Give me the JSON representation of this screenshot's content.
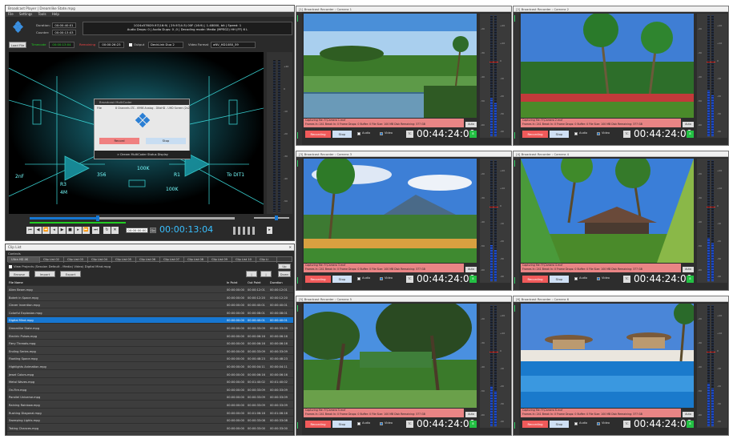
{
  "player": {
    "title": "Broadcast Player | Dreamlike State.mpg",
    "menu": [
      "File",
      "Settings",
      "Tools",
      "Help"
    ],
    "duration_label": "Duration:",
    "duration": "00:00:40:01",
    "counter_label": "Counter:",
    "counter": "00:00:13:03",
    "info_line1": "1024x576i29.97(16:9) | 29.97(4:3) 00F (16:9) | 1.48000, bit | Speed: 1",
    "info_line2": "Audio Drops: 0 | Audio Dups: 0 ,0 | Decoding mode: Media (MPEG2) HH (FF) 6 L",
    "load_file": "Load File",
    "timecode_label": "Timecode",
    "timecode": "00:00:13:04",
    "remaining_label": "Remaining",
    "remaining": "00:00:26:23",
    "output_label": "Output",
    "output_value": "DeckLink Duo 2",
    "video_format_label": "Video Format",
    "video_format_value": "aNV_HD1080_59",
    "big_timecode": "00:00:13:04",
    "tc_field": "00:00:00:00",
    "go": "Go",
    "meter_scale": [
      "+20",
      "0",
      "-10",
      "-20",
      "-30",
      "-40",
      "-50"
    ],
    "dialog": {
      "title": "Broadcast MultiCoder",
      "file_menu": "File",
      "caption": "8 Channels LTC - 6998 Analog - DNxHD - UHD Screen (2x2)",
      "record": "Record",
      "stop": "Stop",
      "footer": "> Dream MultiCoder Status Display"
    },
    "video_text": [
      "2nF",
      "R3",
      "4M",
      "R1",
      "100K",
      "100K",
      "356",
      "To DIT1"
    ]
  },
  "cliplist": {
    "title": "Clip List",
    "controls_label": "Controls",
    "tabs": [
      "Ultra HD 4K",
      "Clip List 02",
      "Clip List 03",
      "Clip List 04",
      "Clip List 05",
      "Clip List 06",
      "Clip List 07",
      "Clip List 08",
      "Clip List 09",
      "Clip List 10",
      "Clip Li"
    ],
    "path_label": "View Projects (Session Default - Media) Video) Digital Mind.mpg",
    "browse": "Browse",
    "import": "Import",
    "export": "Export",
    "up": "Up",
    "down": "Down",
    "headers": [
      "File Name",
      "In Point",
      "Out Point",
      "Duration"
    ],
    "rows": [
      [
        "Alien Beam.mpg",
        "00:00:00:00",
        "00:00:12:01",
        "00:00:12:01"
      ],
      [
        "Bokeh in Space.mpg",
        "00:00:00:00",
        "00:00:12:20",
        "00:00:12:20"
      ],
      [
        "Clever Invention.mpg",
        "00:00:00:00",
        "00:00:40:01",
        "00:00:40:01"
      ],
      [
        "Colorful Explosion.mpg",
        "00:00:00:00",
        "00:00:08:01",
        "00:00:08:01"
      ],
      [
        "Digital Mind.mpg",
        "00:00:00:00",
        "00:00:40:01",
        "00:00:40:01"
      ],
      [
        "Dreamlike State.mpg",
        "00:00:00:00",
        "00:00:33:09",
        "00:00:33:09"
      ],
      [
        "Electric Pulses.mpg",
        "00:00:00:00",
        "00:00:06:16",
        "00:00:06:16"
      ],
      [
        "Fiery Threads.mpg",
        "00:00:00:00",
        "00:00:06:16",
        "00:00:06:16"
      ],
      [
        "Ending Series.mpg",
        "00:00:00:00",
        "00:00:33:09",
        "00:00:33:09"
      ],
      [
        "Floating Space.mpg",
        "00:00:00:00",
        "00:00:48:23",
        "00:00:48:23"
      ],
      [
        "Highlights Animation.mpg",
        "00:00:00:00",
        "00:00:04:11",
        "00:00:04:11"
      ],
      [
        "Jewel Colors.mpg",
        "00:00:00:00",
        "00:00:06:16",
        "00:00:06:16"
      ],
      [
        "Metal Waves.mpg",
        "00:00:00:00",
        "00:01:40:02",
        "00:01:40:02"
      ],
      [
        "On-Fire.mpg",
        "00:00:00:00",
        "00:00:33:09",
        "00:00:33:09"
      ],
      [
        "Parallel Universe.mpg",
        "00:00:00:00",
        "00:00:33:09",
        "00:00:33:09"
      ],
      [
        "Raining Rainbow.mpg",
        "00:00:00:00",
        "00:00:33:09",
        "00:00:33:09"
      ],
      [
        "Rushing Diagonal.mpg",
        "00:00:00:00",
        "00:01:06:16",
        "00:01:06:16"
      ],
      [
        "Sweeping Lights.mpg",
        "00:00:00:00",
        "00:00:33:08",
        "00:00:33:08"
      ],
      [
        "Taking Chances.mpg",
        "00:00:00:00",
        "00:00:33:00",
        "00:00:33:00"
      ]
    ],
    "selected_index": 4
  },
  "cameras": [
    {
      "title": "[1] Broadcast Recorder : Camera 1",
      "capture": "Capturing file: F:\\Camera 1.mxf",
      "frames": "Frames In: 241   Break In: 0   Frame Drops: 0   Buffer: 0   File Size: 100 MB   Disk Remaining: 377 GB",
      "timecode": "00:44:24:00"
    },
    {
      "title": "[2] Broadcast Recorder : Camera 2",
      "capture": "Capturing file: F:\\Camera 2.mxf",
      "frames": "Frames In: 241   Break In: 0   Frame Drops: 0   Buffer: 0   File Size: 100 MB   Disk Remaining: 377 GB",
      "timecode": "00:44:24:00"
    },
    {
      "title": "[3] Broadcast Recorder : Camera 3",
      "capture": "Capturing file: F:\\Camera 3.mxf",
      "frames": "Frames In: 241   Break In: 0   Frame Drops: 0   Buffer: 0   File Size: 100 MB   Disk Remaining: 377 GB",
      "timecode": "00:44:24:00"
    },
    {
      "title": "[4] Broadcast Recorder : Camera 4",
      "capture": "Capturing file: F:\\Camera 4.mxf",
      "frames": "Frames In: 241   Break In: 0   Frame Drops: 0   Buffer: 0   File Size: 100 MB   Disk Remaining: 377 GB",
      "timecode": "00:44:24:00"
    },
    {
      "title": "[5] Broadcast Recorder : Camera 5",
      "capture": "Capturing file: F:\\Camera 5.mxf",
      "frames": "Frames In: 241   Break In: 0   Frame Drops: 0   Buffer: 0   File Size: 100 MB   Disk Remaining: 377 GB",
      "timecode": "00:44:24:00"
    },
    {
      "title": "[6] Broadcast Recorder : Camera 6",
      "capture": "Capturing file: F:\\Camera 6.mxf",
      "frames": "Frames In: 241   Break In: 0   Frame Drops: 0   Buffer: 0   File Size: 100 MB   Disk Remaining: 377 GB",
      "timecode": "00:44:24:00"
    }
  ],
  "camera_common": {
    "recording": "Recording",
    "stop": "Stop",
    "audio": "Audio",
    "video": "Video",
    "tc": "TC",
    "auto": "Auto",
    "green": "8",
    "scale": [
      "-20",
      "-30",
      "-40",
      "-50",
      "-60"
    ],
    "scale_r": [
      "+20",
      "+10",
      "0",
      "-10",
      "-20",
      "-30",
      "-40"
    ]
  },
  "colors": {
    "accent": "#1677d2",
    "record": "#f05a5a",
    "status": "#e98585",
    "meter": "#2864ff",
    "ok": "#23c043"
  }
}
